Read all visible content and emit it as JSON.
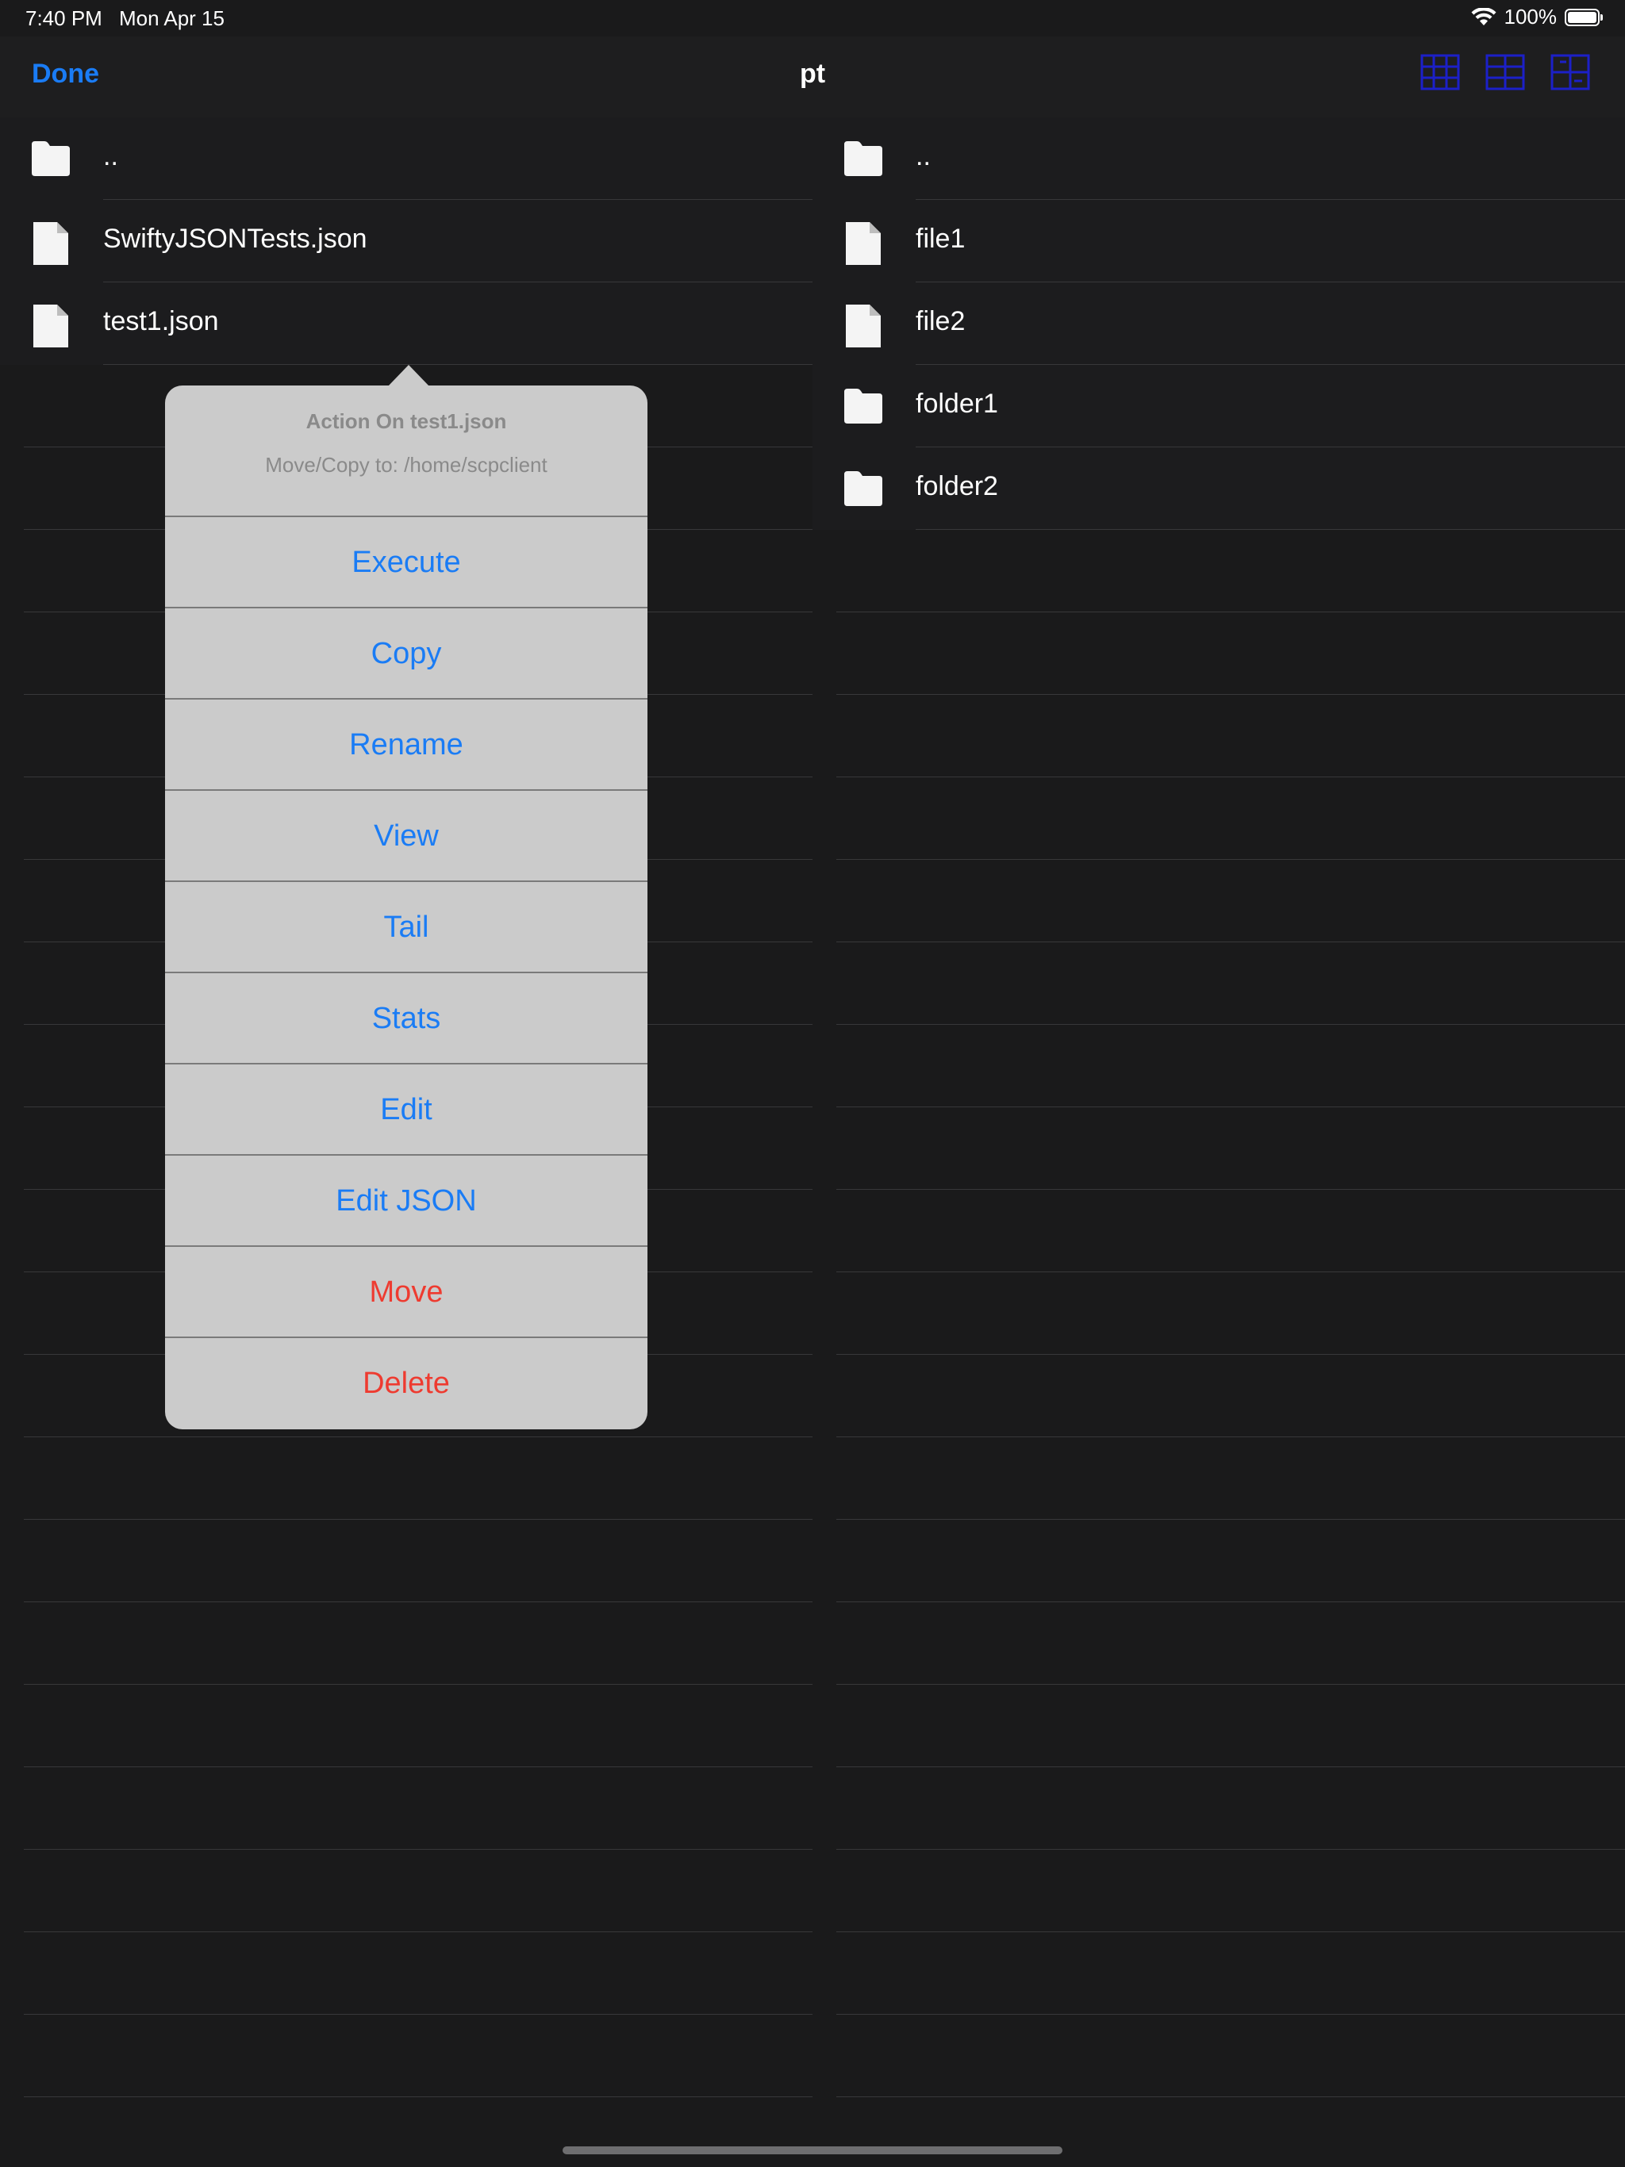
{
  "status_bar": {
    "time": "7:40 PM",
    "date": "Mon Apr 15",
    "battery": "100%",
    "wifi_icon": "wifi-icon",
    "battery_icon": "battery-icon"
  },
  "nav_bar": {
    "done_label": "Done",
    "title": "pt",
    "layout_icons": [
      "grid-layout-icon",
      "columns-layout-icon",
      "split-layout-icon"
    ]
  },
  "left_panel": {
    "items": [
      {
        "name": "..",
        "type": "folder"
      },
      {
        "name": "SwiftyJSONTests.json",
        "type": "file"
      },
      {
        "name": "test1.json",
        "type": "file"
      }
    ]
  },
  "right_panel": {
    "items": [
      {
        "name": "..",
        "type": "folder"
      },
      {
        "name": "file1",
        "type": "file"
      },
      {
        "name": "file2",
        "type": "file"
      },
      {
        "name": "folder1",
        "type": "folder"
      },
      {
        "name": "folder2",
        "type": "folder"
      }
    ]
  },
  "action_sheet": {
    "title": "Action On test1.json",
    "message": "Move/Copy to: /home/scpclient",
    "actions": [
      {
        "label": "Execute",
        "style": "default"
      },
      {
        "label": "Copy",
        "style": "default"
      },
      {
        "label": "Rename",
        "style": "default"
      },
      {
        "label": "View",
        "style": "default"
      },
      {
        "label": "Tail",
        "style": "default"
      },
      {
        "label": "Stats",
        "style": "default"
      },
      {
        "label": "Edit",
        "style": "default"
      },
      {
        "label": "Edit JSON",
        "style": "default"
      },
      {
        "label": "Move",
        "style": "destructive"
      },
      {
        "label": "Delete",
        "style": "destructive"
      }
    ]
  },
  "colors": {
    "accent": "#1a7cf5",
    "destructive": "#ee3b30",
    "background": "#1a1a1b",
    "popover": "#cbcbcb",
    "layout_icon": "#1c20c8"
  }
}
